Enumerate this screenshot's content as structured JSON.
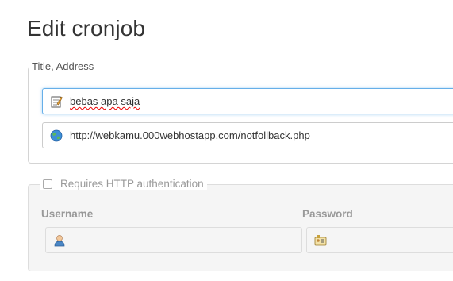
{
  "page": {
    "title": "Edit cronjob"
  },
  "title_address": {
    "legend": "Title, Address",
    "title_value": "bebas apa saja",
    "title_icon": "notepad-icon",
    "url_value": "http://webkamu.000webhostapp.com/notfollback.php",
    "url_icon": "globe-icon"
  },
  "auth": {
    "legend": "Requires HTTP authentication",
    "checked": false,
    "username_label": "Username",
    "password_label": "Password",
    "username_icon": "user-icon",
    "password_icon": "id-card-icon"
  },
  "colors": {
    "focus_border": "#66afe9",
    "label_disabled": "#999999"
  }
}
